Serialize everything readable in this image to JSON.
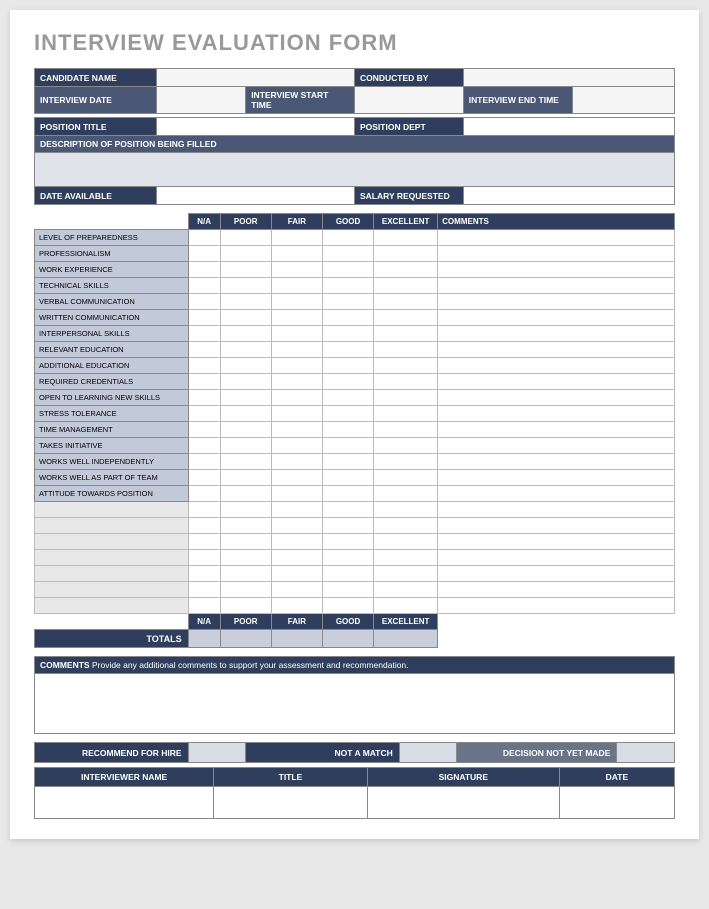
{
  "title": "INTERVIEW EVALUATION FORM",
  "header": {
    "candidate_name": "CANDIDATE NAME",
    "conducted_by": "CONDUCTED BY",
    "interview_date": "INTERVIEW DATE",
    "interview_start_time": "INTERVIEW START TIME",
    "interview_end_time": "INTERVIEW END TIME",
    "position_title": "POSITION TITLE",
    "position_dept": "POSITION DEPT",
    "description": "DESCRIPTION OF POSITION BEING FILLED",
    "date_available": "DATE AVAILABLE",
    "salary_requested": "SALARY REQUESTED"
  },
  "eval": {
    "cols": [
      "N/A",
      "POOR",
      "FAIR",
      "GOOD",
      "EXCELLENT",
      "COMMENTS"
    ],
    "rows": [
      "LEVEL OF PREPAREDNESS",
      "PROFESSIONALISM",
      "WORK EXPERIENCE",
      "TECHNICAL SKILLS",
      "VERBAL COMMUNICATION",
      "WRITTEN COMMUNICATION",
      "INTERPERSONAL SKILLS",
      "RELEVANT EDUCATION",
      "ADDITIONAL EDUCATION",
      "REQUIRED CREDENTIALS",
      "OPEN TO LEARNING NEW SKILLS",
      "STRESS TOLERANCE",
      "TIME MANAGEMENT",
      "TAKES INITIATIVE",
      "WORKS WELL INDEPENDENTLY",
      "WORKS WELL AS PART OF TEAM",
      "ATTITUDE TOWARDS POSITION"
    ],
    "empty_rows": 7,
    "footer_cols": [
      "N/A",
      "POOR",
      "FAIR",
      "GOOD",
      "EXCELLENT"
    ],
    "totals": "TOTALS"
  },
  "comments": {
    "label": "COMMENTS",
    "text": "Provide any additional comments to support your assessment and recommendation."
  },
  "recommendation": {
    "recommend": "RECOMMEND FOR HIRE",
    "not_match": "NOT A MATCH",
    "not_decided": "DECISION NOT YET MADE"
  },
  "signature": {
    "interviewer": "INTERVIEWER NAME",
    "title": "TITLE",
    "signature": "SIGNATURE",
    "date": "DATE"
  }
}
